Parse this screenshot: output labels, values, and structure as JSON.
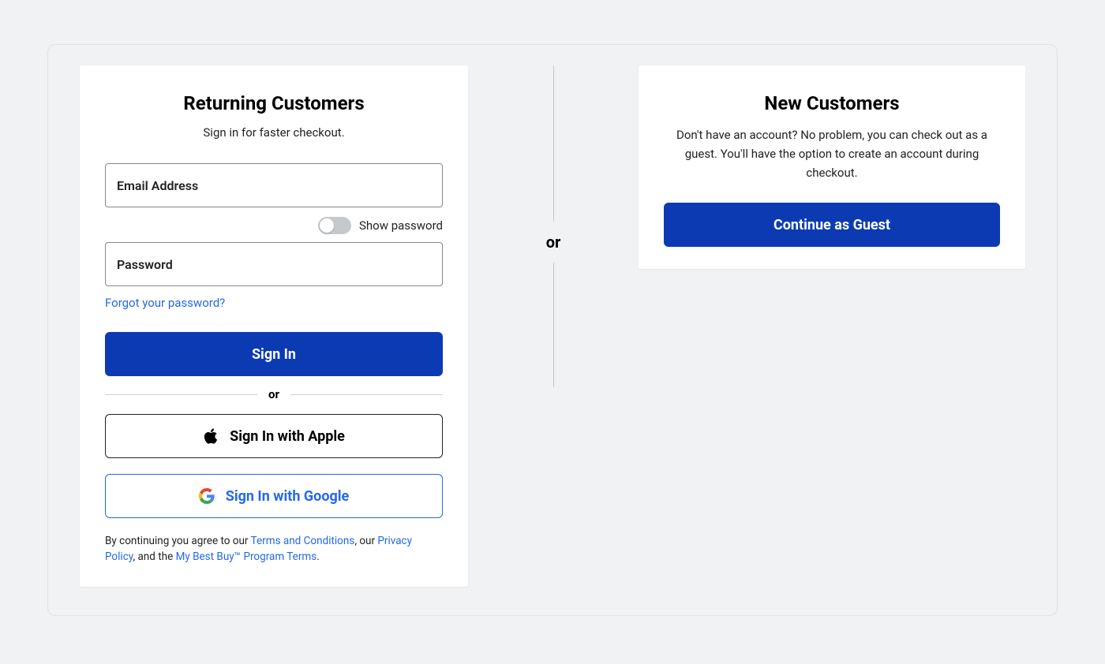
{
  "returning": {
    "title": "Returning Customers",
    "subtitle": "Sign in for faster checkout.",
    "email_placeholder": "Email Address",
    "email_value": "",
    "password_placeholder": "Password",
    "password_value": "",
    "show_password_label": "Show password",
    "show_password_on": false,
    "forgot_link": "Forgot your password?",
    "signin_label": "Sign In",
    "or_label": "or",
    "apple_label": "Sign In with Apple",
    "google_label": "Sign In with Google",
    "legal_pre": "By continuing you agree to our ",
    "legal_terms": "Terms and Conditions",
    "legal_mid1": ", our ",
    "legal_privacy": "Privacy Policy",
    "legal_mid2": ", and the ",
    "legal_mbb": "My Best Buy™ Program Terms",
    "legal_post": "."
  },
  "divider_or": "or",
  "new": {
    "title": "New Customers",
    "subtitle": "Don't have an account? No problem, you can check out as a guest. You'll have the option to create an account during checkout.",
    "guest_label": "Continue as Guest"
  }
}
